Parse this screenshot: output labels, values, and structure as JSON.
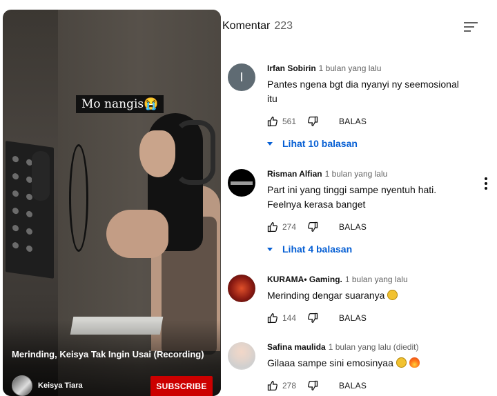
{
  "video": {
    "caption": "Mo nangis😭",
    "title": "Merinding, Keisya Tak Ingin Usai (Recording)",
    "channel": "Keisya Tiara",
    "subscribe_label": "SUBSCRIBE"
  },
  "comments_header": {
    "label": "Komentar",
    "count": "223"
  },
  "comments": [
    {
      "author": "Irfan Sobirin",
      "time": "1 bulan yang lalu",
      "text_lines": [
        "Pantes ngena bgt dia nyanyi ny seemosional",
        "itu"
      ],
      "likes": "561",
      "reply_label": "BALAS",
      "replies": "Lihat 10 balasan",
      "avatar_letter": "I",
      "avatar_color": "#5f6b73"
    },
    {
      "author": "Risman Alfian",
      "time": "1 bulan yang lalu",
      "text_lines": [
        "Part ini yang tinggi sampe nyentuh hati.",
        "Feelnya kerasa banget"
      ],
      "likes": "274",
      "reply_label": "BALAS",
      "replies": "Lihat 4 balasan",
      "avatar_color": "#000000"
    },
    {
      "author": "KURAMA• Gaming.",
      "time": "1 bulan yang lalu",
      "text": "Merinding dengar suaranya",
      "likes": "144",
      "reply_label": "BALAS",
      "avatar_color": "#7a1410"
    },
    {
      "author": "Safina maulida",
      "time": "1 bulan yang lalu (diedit)",
      "text": "Gilaaa sampe sini emosinyaa",
      "likes": "278",
      "reply_label": "BALAS",
      "avatar_color": "#e9e6e3"
    }
  ],
  "icons": {
    "like": "thumbs-up-icon",
    "dislike": "thumbs-down-icon",
    "sort": "sort-icon",
    "more": "more-vert-icon",
    "expand": "triangle-down-icon"
  },
  "colors": {
    "accent_blue": "#065fd4",
    "subscribe_red": "#cc0000",
    "meta_gray": "#606060"
  }
}
